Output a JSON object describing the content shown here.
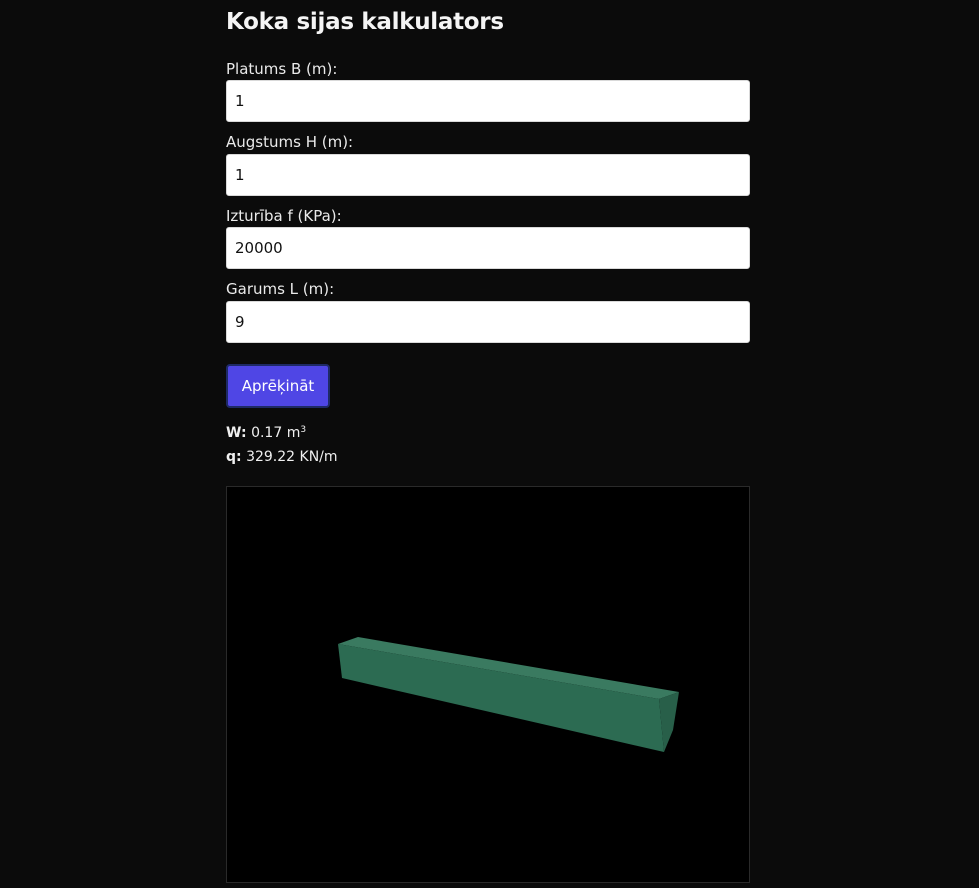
{
  "page": {
    "title": "Koka sijas kalkulators"
  },
  "form": {
    "width": {
      "label": "Platums B (m):",
      "value": "1"
    },
    "height": {
      "label": "Augstums H (m):",
      "value": "1"
    },
    "strength": {
      "label": "Izturība f (KPa):",
      "value": "20000"
    },
    "length": {
      "label": "Garums L (m):",
      "value": "9"
    },
    "calculate_label": "Aprēķināt"
  },
  "results": {
    "w_label": "W:",
    "w_value": "0.17 m",
    "w_unit_exponent": "3",
    "q_label": "q:",
    "q_value": "329.22 KN/m"
  },
  "viewport": {
    "background": "#000000",
    "beam_colors": {
      "front": "#2c6b52",
      "top": "#3a7a60",
      "end": "#285f49"
    }
  }
}
